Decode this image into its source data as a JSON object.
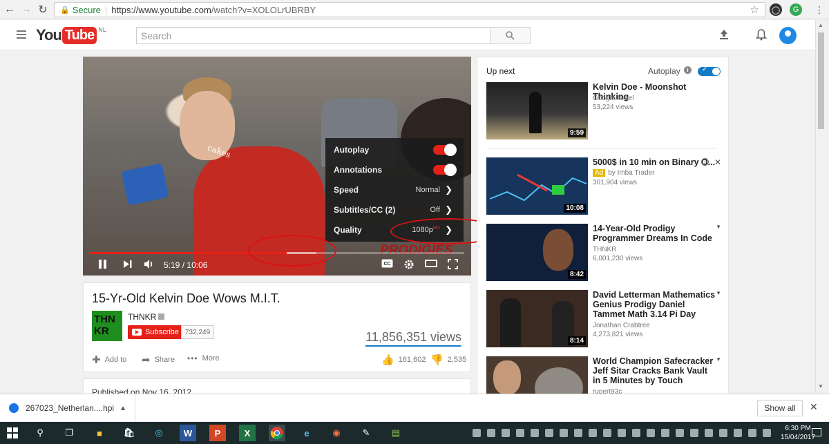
{
  "browser": {
    "secure_label": "Secure",
    "url_prefix": "https://www.youtube.com",
    "url_path": "/watch?v=XOLOLrUBRBY"
  },
  "header": {
    "logo_you": "You",
    "logo_tube": "Tube",
    "logo_region": "NL",
    "search_placeholder": "Search"
  },
  "player": {
    "current_time": "5:19",
    "time_separator": "/",
    "duration": "10:06",
    "progress_fraction": 0.526,
    "watermark": "PRODIGIES",
    "shirt_text": "cakes",
    "settings": [
      {
        "label": "Autoplay",
        "type": "toggle",
        "on": true
      },
      {
        "label": "Annotations",
        "type": "toggle",
        "on": true
      },
      {
        "label": "Speed",
        "type": "submenu",
        "value": "Normal"
      },
      {
        "label": "Subtitles/CC (2)",
        "type": "submenu",
        "value": "Off"
      },
      {
        "label": "Quality",
        "type": "submenu",
        "value": "1080p",
        "badge": "HD"
      }
    ]
  },
  "video": {
    "title": "15-Yr-Old Kelvin Doe Wows M.I.T.",
    "channel": "THNKR",
    "channel_thumb_text": "THN KR",
    "subscribe_label": "Subscribe",
    "subscriber_count": "732,249",
    "views": "11,856,351 views",
    "add_to": "Add to",
    "share": "Share",
    "more": "More",
    "likes": "161,602",
    "dislikes": "2,535",
    "like_fraction": 0.985,
    "published": "Published on Nov 16, 2012"
  },
  "upnext": {
    "title": "Up next",
    "autoplay_label": "Autoplay",
    "autoplay_on": true,
    "items": [
      {
        "title": "Kelvin Doe - Moonshot Thinking",
        "channel": "Google Israel",
        "views": "53,224 views",
        "duration": "9:59"
      },
      {
        "title": "5000$ in 10 min on Binary O...",
        "ad_label": "Ad",
        "channel": "by Imba Trader",
        "views": "301,904 views",
        "duration": "10:08"
      },
      {
        "title": "14-Year-Old Prodigy Programmer Dreams In Code",
        "channel": "THNKR",
        "views": "6,001,230 views",
        "duration": "8:42"
      },
      {
        "title": "David Letterman Mathematics Genius Prodigy Daniel Tammet Math 3.14 Pi Day",
        "channel": "Jonathan Crabtree",
        "views": "4,273,821 views",
        "duration": "8:14"
      },
      {
        "title": "World Champion Safecracker Jeff Sitar Cracks Bank Vault in 5 Minutes by Touch",
        "channel": "rupert93c",
        "views": "",
        "duration": ""
      }
    ]
  },
  "downloads": {
    "file_name": "267023_Netherlan....hpi",
    "show_all": "Show all"
  },
  "taskbar": {
    "time": "6:30 PM",
    "date": "15/04/2017"
  },
  "colors": {
    "youtube_red": "#e62117",
    "link_blue": "#167ac6",
    "annotation_circle": "#dd1111"
  }
}
